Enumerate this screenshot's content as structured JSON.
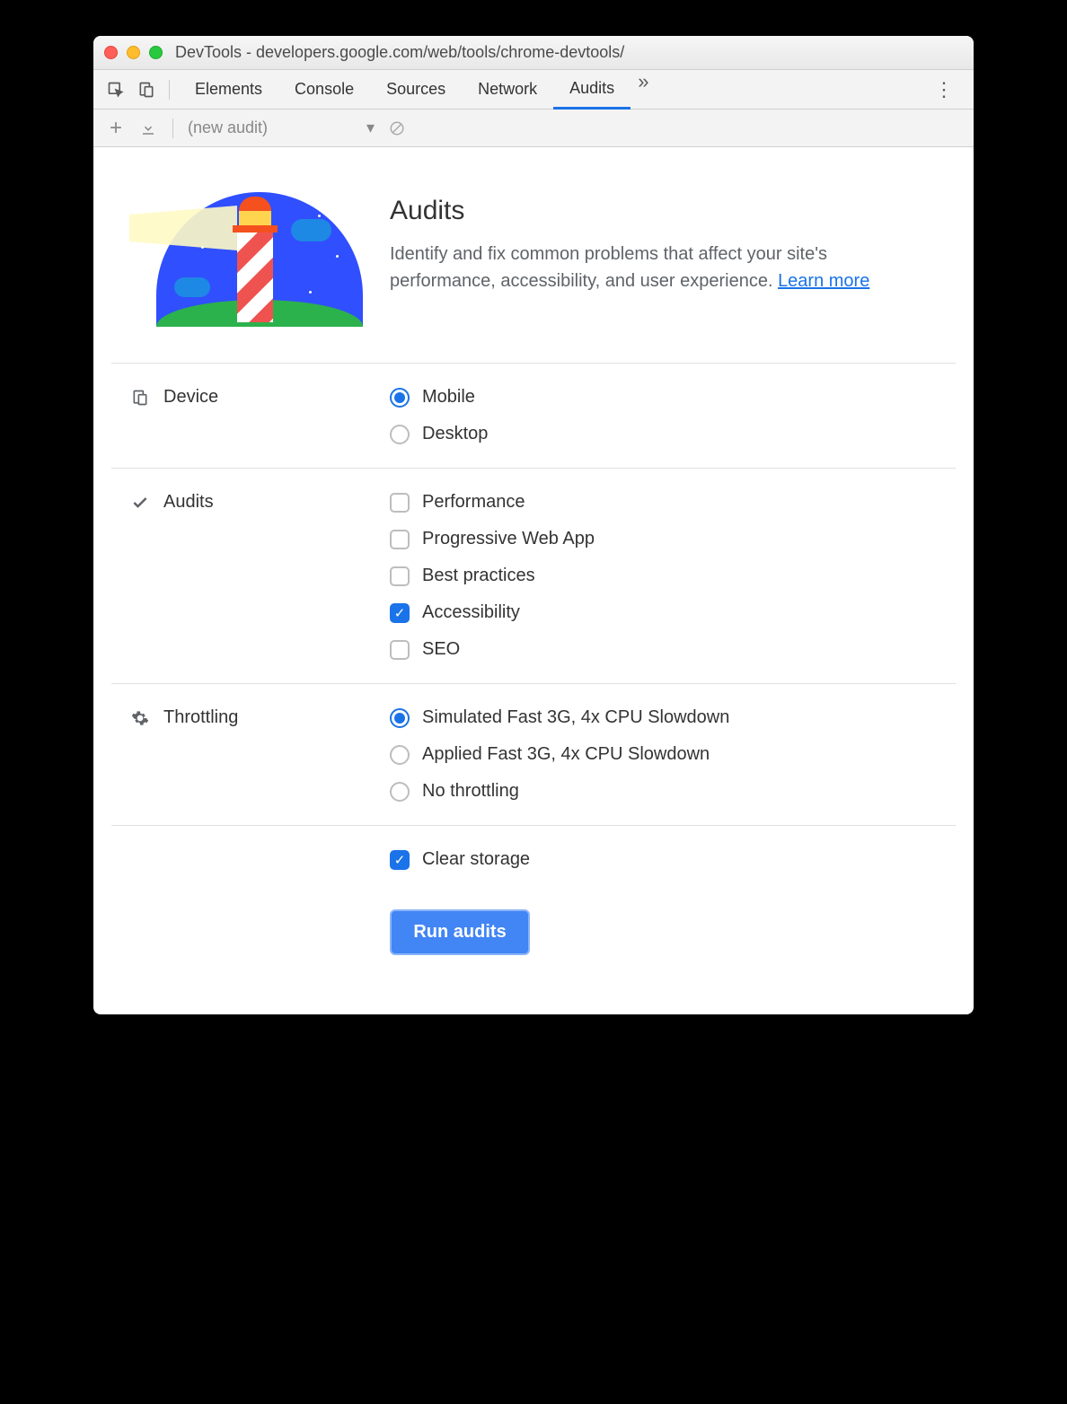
{
  "window": {
    "title": "DevTools - developers.google.com/web/tools/chrome-devtools/"
  },
  "tabs": {
    "items": [
      "Elements",
      "Console",
      "Sources",
      "Network",
      "Audits"
    ],
    "active": "Audits"
  },
  "toolbar": {
    "dropdown": "(new audit)"
  },
  "hero": {
    "title": "Audits",
    "description": "Identify and fix common problems that affect your site's performance, accessibility, and user experience. ",
    "learn_more": "Learn more"
  },
  "sections": {
    "device": {
      "label": "Device",
      "options": [
        {
          "label": "Mobile",
          "checked": true
        },
        {
          "label": "Desktop",
          "checked": false
        }
      ]
    },
    "audits": {
      "label": "Audits",
      "options": [
        {
          "label": "Performance",
          "checked": false
        },
        {
          "label": "Progressive Web App",
          "checked": false
        },
        {
          "label": "Best practices",
          "checked": false
        },
        {
          "label": "Accessibility",
          "checked": true
        },
        {
          "label": "SEO",
          "checked": false
        }
      ]
    },
    "throttling": {
      "label": "Throttling",
      "options": [
        {
          "label": "Simulated Fast 3G, 4x CPU Slowdown",
          "checked": true
        },
        {
          "label": "Applied Fast 3G, 4x CPU Slowdown",
          "checked": false
        },
        {
          "label": "No throttling",
          "checked": false
        }
      ]
    },
    "storage": {
      "clear_label": "Clear storage",
      "clear_checked": true
    }
  },
  "run_button": "Run audits"
}
